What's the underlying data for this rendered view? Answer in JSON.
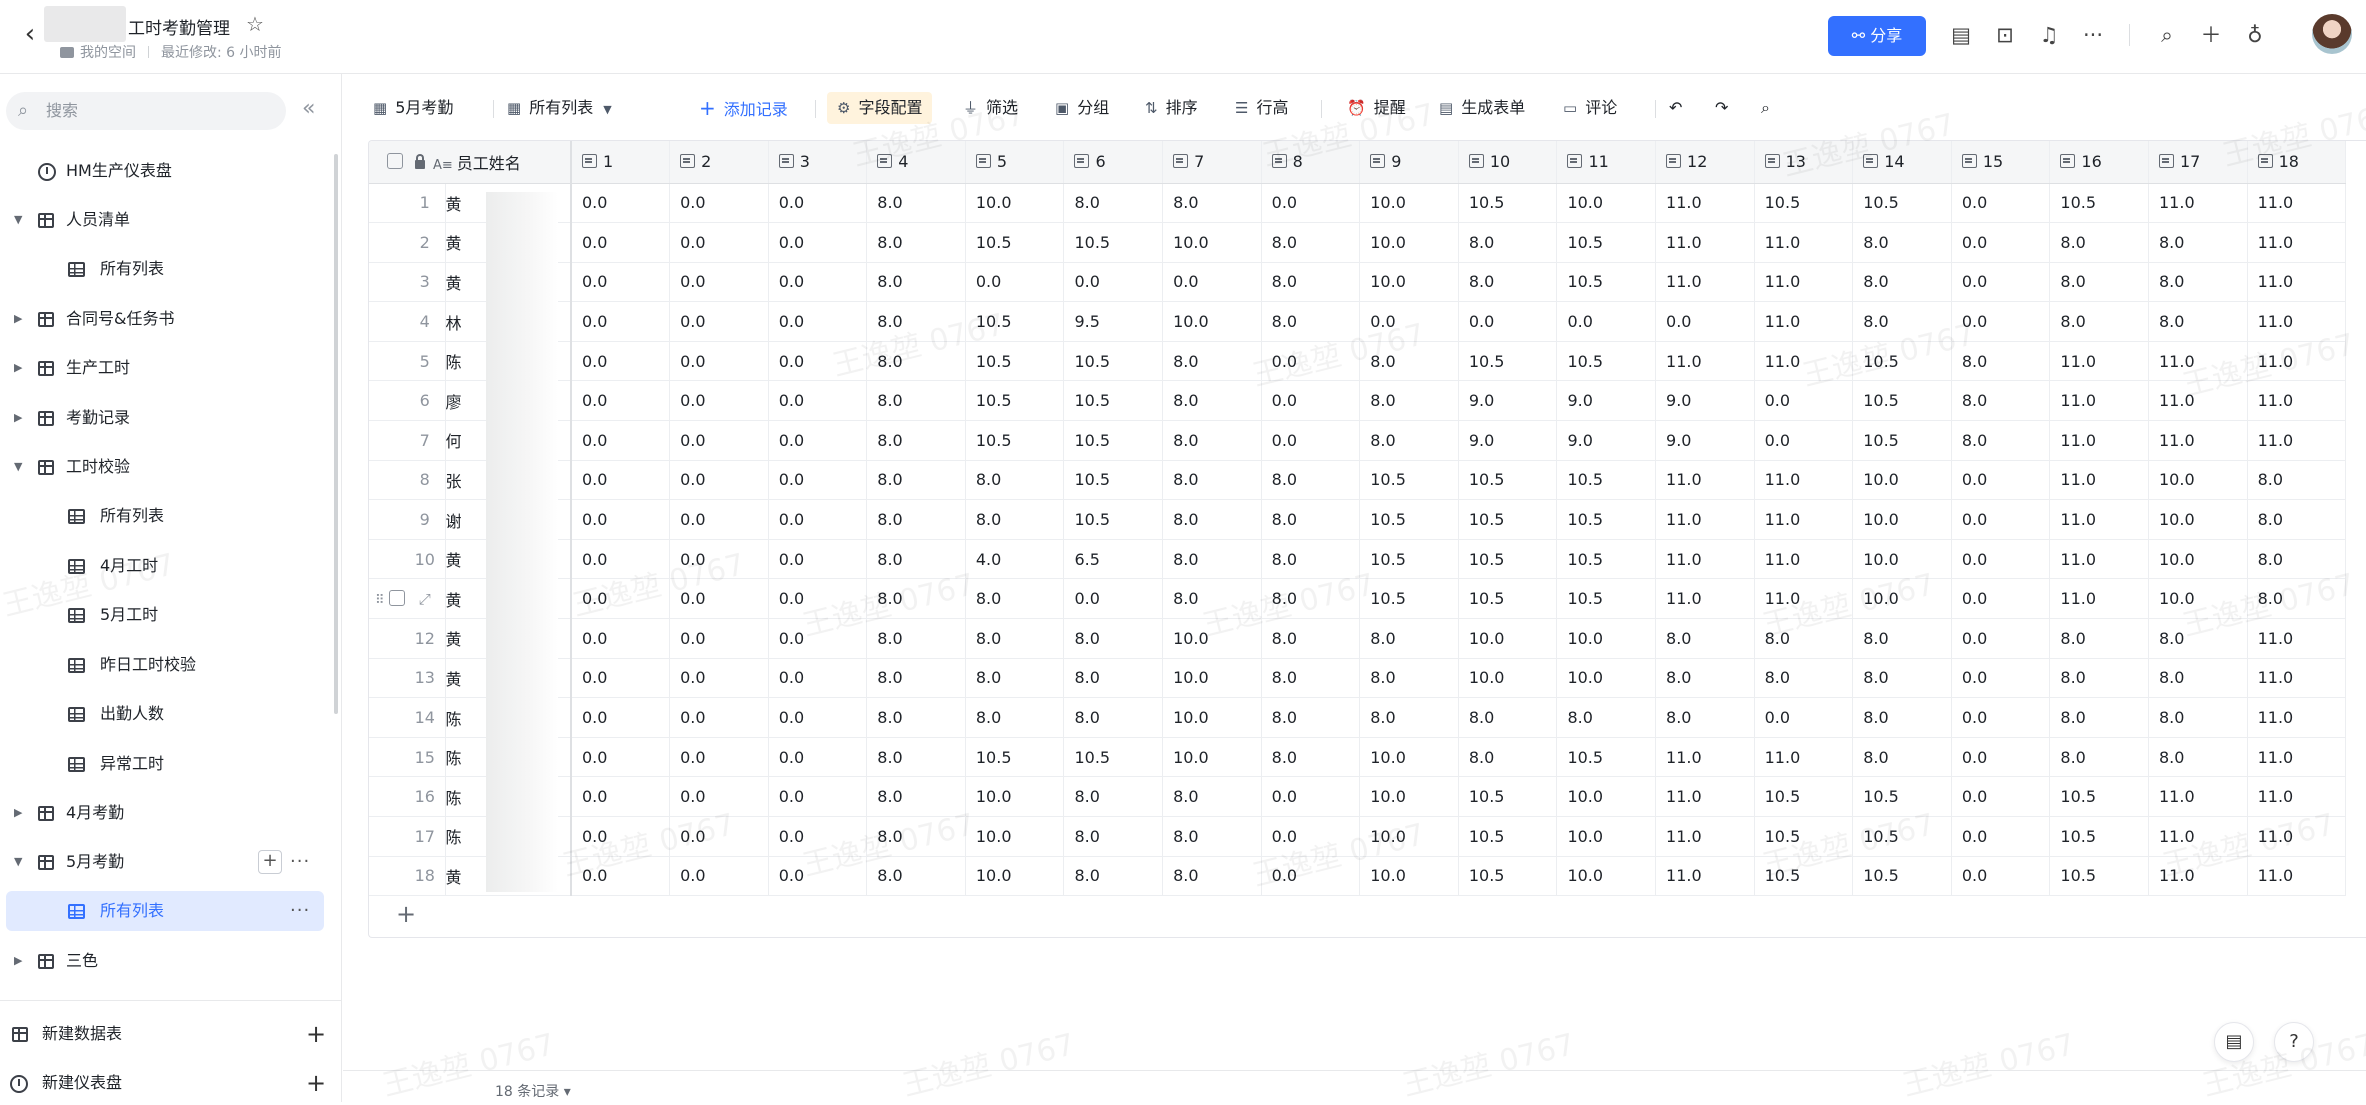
{
  "header": {
    "title": "工时考勤管理",
    "space": "我的空间",
    "modified": "最近修改: 6 小时前",
    "share_label": "分享"
  },
  "sidebar": {
    "search_placeholder": "搜索",
    "items": [
      {
        "label": "HM生产仪表盘",
        "icon": "dashboard-icon"
      },
      {
        "label": "人员清单",
        "icon": "table-icon"
      },
      {
        "label": "所有列表",
        "icon": "grid-view-icon"
      },
      {
        "label": "合同号&任务书",
        "icon": "table-icon"
      },
      {
        "label": "生产工时",
        "icon": "table-icon"
      },
      {
        "label": "考勤记录",
        "icon": "table-icon"
      },
      {
        "label": "工时校验",
        "icon": "table-icon"
      },
      {
        "label": "所有列表",
        "icon": "grid-view-icon"
      },
      {
        "label": "4月工时",
        "icon": "grid-view-icon"
      },
      {
        "label": "5月工时",
        "icon": "grid-view-icon"
      },
      {
        "label": "昨日工时校验",
        "icon": "grid-view-icon"
      },
      {
        "label": "出勤人数",
        "icon": "grid-view-icon"
      },
      {
        "label": "异常工时",
        "icon": "grid-view-icon"
      },
      {
        "label": "4月考勤",
        "icon": "table-icon"
      },
      {
        "label": "5月考勤",
        "icon": "table-icon"
      },
      {
        "label": "所有列表",
        "icon": "grid-view-icon"
      },
      {
        "label": "三色",
        "icon": "table-icon"
      }
    ],
    "new_table": "新建数据表",
    "new_dashboard": "新建仪表盘"
  },
  "toolbar": {
    "table_name": "5月考勤",
    "view_name": "所有列表",
    "add_record": "添加记录",
    "field_config": "字段配置",
    "filter": "筛选",
    "group": "分组",
    "sort": "排序",
    "row_height": "行高",
    "remind": "提醒",
    "gen_form": "生成表单",
    "comment": "评论"
  },
  "table": {
    "name_header": "员工姓名",
    "columns": [
      "1",
      "2",
      "3",
      "4",
      "5",
      "6",
      "7",
      "8",
      "9",
      "10",
      "11",
      "12",
      "13",
      "14",
      "15",
      "16",
      "17",
      "18"
    ],
    "rows": [
      {
        "n": "1",
        "name": "黄",
        "v": [
          "0.0",
          "0.0",
          "0.0",
          "8.0",
          "10.0",
          "8.0",
          "8.0",
          "0.0",
          "10.0",
          "10.5",
          "10.0",
          "11.0",
          "10.5",
          "10.5",
          "0.0",
          "10.5",
          "11.0",
          "11.0"
        ]
      },
      {
        "n": "2",
        "name": "黄",
        "v": [
          "0.0",
          "0.0",
          "0.0",
          "8.0",
          "10.5",
          "10.5",
          "10.0",
          "8.0",
          "10.0",
          "8.0",
          "10.5",
          "11.0",
          "11.0",
          "8.0",
          "0.0",
          "8.0",
          "8.0",
          "11.0"
        ]
      },
      {
        "n": "3",
        "name": "黄",
        "v": [
          "0.0",
          "0.0",
          "0.0",
          "8.0",
          "0.0",
          "0.0",
          "0.0",
          "8.0",
          "10.0",
          "8.0",
          "10.5",
          "11.0",
          "11.0",
          "8.0",
          "0.0",
          "8.0",
          "8.0",
          "11.0"
        ]
      },
      {
        "n": "4",
        "name": "林",
        "v": [
          "0.0",
          "0.0",
          "0.0",
          "8.0",
          "10.5",
          "9.5",
          "10.0",
          "8.0",
          "0.0",
          "0.0",
          "0.0",
          "0.0",
          "11.0",
          "8.0",
          "0.0",
          "8.0",
          "8.0",
          "11.0"
        ]
      },
      {
        "n": "5",
        "name": "陈",
        "v": [
          "0.0",
          "0.0",
          "0.0",
          "8.0",
          "10.5",
          "10.5",
          "8.0",
          "0.0",
          "8.0",
          "10.5",
          "10.5",
          "11.0",
          "11.0",
          "10.5",
          "8.0",
          "11.0",
          "11.0",
          "11.0"
        ]
      },
      {
        "n": "6",
        "name": "廖",
        "v": [
          "0.0",
          "0.0",
          "0.0",
          "8.0",
          "10.5",
          "10.5",
          "8.0",
          "0.0",
          "8.0",
          "9.0",
          "9.0",
          "9.0",
          "0.0",
          "10.5",
          "8.0",
          "11.0",
          "11.0",
          "11.0"
        ]
      },
      {
        "n": "7",
        "name": "何",
        "v": [
          "0.0",
          "0.0",
          "0.0",
          "8.0",
          "10.5",
          "10.5",
          "8.0",
          "0.0",
          "8.0",
          "9.0",
          "9.0",
          "9.0",
          "0.0",
          "10.5",
          "8.0",
          "11.0",
          "11.0",
          "11.0"
        ]
      },
      {
        "n": "8",
        "name": "张",
        "v": [
          "0.0",
          "0.0",
          "0.0",
          "8.0",
          "8.0",
          "10.5",
          "8.0",
          "8.0",
          "10.5",
          "10.5",
          "10.5",
          "11.0",
          "11.0",
          "10.0",
          "0.0",
          "11.0",
          "10.0",
          "8.0"
        ]
      },
      {
        "n": "9",
        "name": "谢",
        "v": [
          "0.0",
          "0.0",
          "0.0",
          "8.0",
          "8.0",
          "10.5",
          "8.0",
          "8.0",
          "10.5",
          "10.5",
          "10.5",
          "11.0",
          "11.0",
          "10.0",
          "0.0",
          "11.0",
          "10.0",
          "8.0"
        ]
      },
      {
        "n": "10",
        "name": "黄",
        "v": [
          "0.0",
          "0.0",
          "0.0",
          "8.0",
          "4.0",
          "6.5",
          "8.0",
          "8.0",
          "10.5",
          "10.5",
          "10.5",
          "11.0",
          "11.0",
          "10.0",
          "0.0",
          "11.0",
          "10.0",
          "8.0"
        ]
      },
      {
        "n": "",
        "name": "黄",
        "v": [
          "0.0",
          "0.0",
          "0.0",
          "8.0",
          "8.0",
          "0.0",
          "8.0",
          "8.0",
          "10.5",
          "10.5",
          "10.5",
          "11.0",
          "11.0",
          "10.0",
          "0.0",
          "11.0",
          "10.0",
          "8.0"
        ]
      },
      {
        "n": "12",
        "name": "黄",
        "v": [
          "0.0",
          "0.0",
          "0.0",
          "8.0",
          "8.0",
          "8.0",
          "10.0",
          "8.0",
          "8.0",
          "10.0",
          "10.0",
          "8.0",
          "8.0",
          "8.0",
          "0.0",
          "8.0",
          "8.0",
          "11.0"
        ]
      },
      {
        "n": "13",
        "name": "黄",
        "v": [
          "0.0",
          "0.0",
          "0.0",
          "8.0",
          "8.0",
          "8.0",
          "10.0",
          "8.0",
          "8.0",
          "10.0",
          "10.0",
          "8.0",
          "8.0",
          "8.0",
          "0.0",
          "8.0",
          "8.0",
          "11.0"
        ]
      },
      {
        "n": "14",
        "name": "陈",
        "v": [
          "0.0",
          "0.0",
          "0.0",
          "8.0",
          "8.0",
          "8.0",
          "10.0",
          "8.0",
          "8.0",
          "8.0",
          "8.0",
          "8.0",
          "0.0",
          "8.0",
          "0.0",
          "8.0",
          "8.0",
          "11.0"
        ]
      },
      {
        "n": "15",
        "name": "陈",
        "v": [
          "0.0",
          "0.0",
          "0.0",
          "8.0",
          "10.5",
          "10.5",
          "10.0",
          "8.0",
          "10.0",
          "8.0",
          "10.5",
          "11.0",
          "11.0",
          "8.0",
          "0.0",
          "8.0",
          "8.0",
          "11.0"
        ]
      },
      {
        "n": "16",
        "name": "陈",
        "v": [
          "0.0",
          "0.0",
          "0.0",
          "8.0",
          "10.0",
          "8.0",
          "8.0",
          "0.0",
          "10.0",
          "10.5",
          "10.0",
          "11.0",
          "10.5",
          "10.5",
          "0.0",
          "10.5",
          "11.0",
          "11.0"
        ]
      },
      {
        "n": "17",
        "name": "陈",
        "v": [
          "0.0",
          "0.0",
          "0.0",
          "8.0",
          "10.0",
          "8.0",
          "8.0",
          "0.0",
          "10.0",
          "10.5",
          "10.0",
          "11.0",
          "10.5",
          "10.5",
          "0.0",
          "10.5",
          "11.0",
          "11.0"
        ]
      },
      {
        "n": "18",
        "name": "黄",
        "v": [
          "0.0",
          "0.0",
          "0.0",
          "8.0",
          "10.0",
          "8.0",
          "8.0",
          "0.0",
          "10.0",
          "10.5",
          "10.0",
          "11.0",
          "10.5",
          "10.5",
          "0.0",
          "10.5",
          "11.0",
          "11.0"
        ]
      }
    ]
  },
  "footer": {
    "record_count": "18 条记录"
  },
  "watermark": "王逸堃 0767",
  "colors": {
    "accent": "#3370ff",
    "active_bg": "#e1eaff",
    "highlight_bg": "#fff3dd"
  }
}
